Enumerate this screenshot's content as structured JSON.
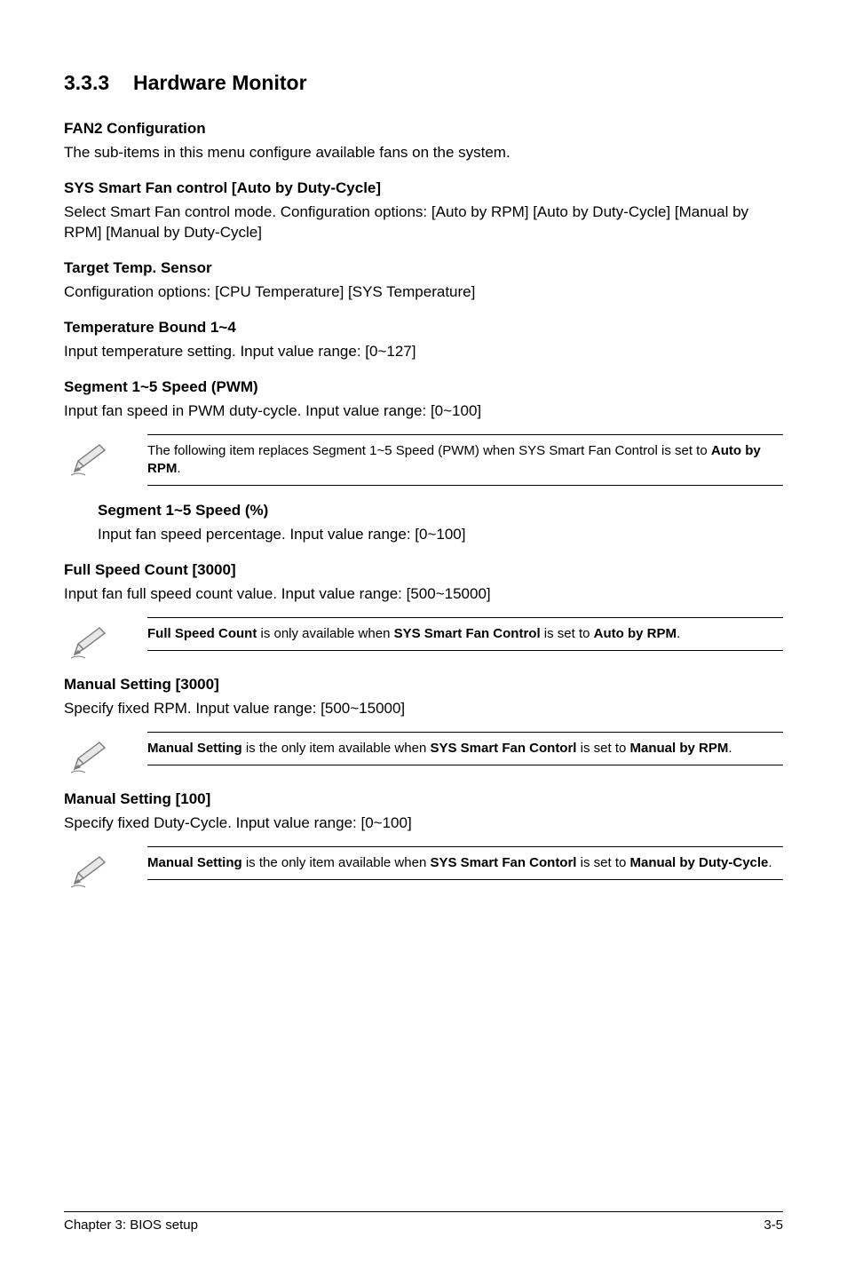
{
  "section": {
    "number": "3.3.3",
    "title": "Hardware Monitor"
  },
  "headings": {
    "fan2_config": "FAN2 Configuration",
    "sys_smart_fan": "SYS Smart Fan control [Auto by Duty-Cycle]",
    "target_temp": "Target Temp. Sensor",
    "temp_bound": "Temperature Bound 1~4",
    "seg_pwm": "Segment 1~5 Speed (PWM)",
    "seg_pct": "Segment 1~5 Speed (%)",
    "full_speed": "Full Speed Count [3000]",
    "manual_3000": "Manual Setting [3000]",
    "manual_100": "Manual Setting [100]"
  },
  "body": {
    "fan2_config": "The sub-items in this menu configure available fans on the system.",
    "sys_smart_fan": "Select Smart Fan control mode. Configuration options: [Auto by RPM] [Auto by Duty-Cycle] [Manual by RPM] [Manual by Duty-Cycle]",
    "target_temp": "Configuration options: [CPU Temperature] [SYS Temperature]",
    "temp_bound": "Input temperature setting. Input value range: [0~127]",
    "seg_pwm": "Input fan speed in PWM duty-cycle. Input value range: [0~100]",
    "seg_pct": "Input fan speed percentage. Input value range: [0~100]",
    "full_speed": "Input fan full speed count value. Input value range: [500~15000]",
    "manual_3000": "Specify fixed RPM. Input value range: [500~15000]",
    "manual_100": "Specify fixed Duty-Cycle. Input value range: [0~100]"
  },
  "notes": {
    "note1_pre": "The following item replaces Segment 1~5 Speed (PWM) when SYS Smart Fan Control is set to ",
    "note1_bold": "Auto by RPM",
    "note1_post": ".",
    "note2_b1": "Full Speed Count",
    "note2_mid": " is only available when ",
    "note2_b2": "SYS Smart Fan Control",
    "note2_mid2": " is set to ",
    "note2_b3": "Auto by RPM",
    "note2_post": ".",
    "note3_b1": "Manual Setting",
    "note3_mid": " is the only item available when ",
    "note3_b2": "SYS Smart Fan Contorl",
    "note3_mid2": " is set to ",
    "note3_b3": "Manual by RPM",
    "note3_post": ".",
    "note4_b1": "Manual Setting",
    "note4_mid": " is the only item available when ",
    "note4_b2": "SYS Smart Fan Contorl",
    "note4_mid2": " is set to ",
    "note4_b3": "Manual by Duty-Cycle",
    "note4_post": "."
  },
  "footer": {
    "left": "Chapter 3: BIOS setup",
    "right": "3-5"
  }
}
